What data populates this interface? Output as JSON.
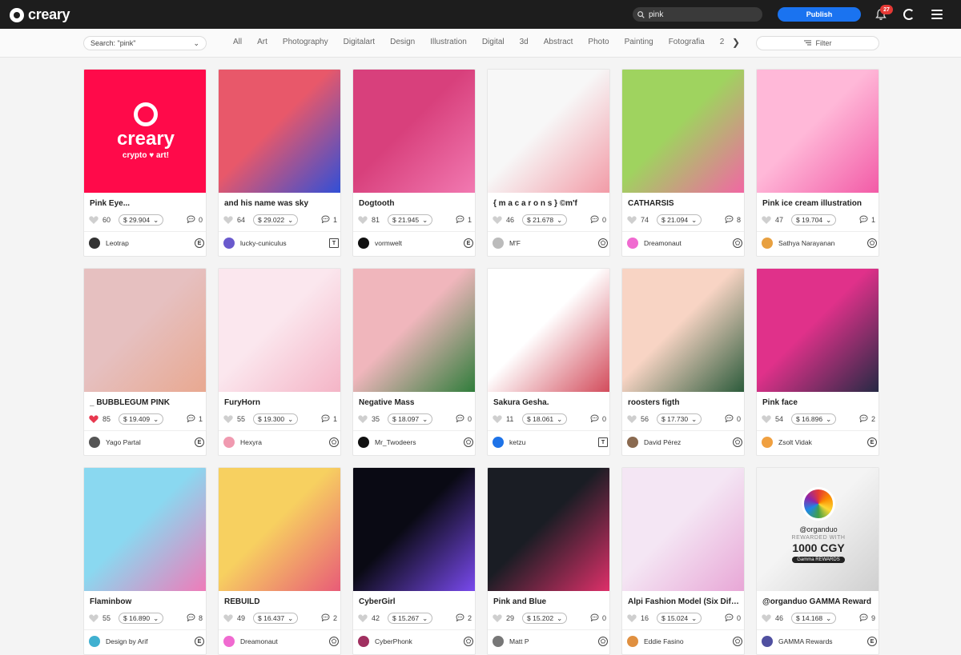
{
  "header": {
    "logo_text": "creary",
    "search_value": "pink",
    "publish_label": "Publish",
    "notification_count": "27",
    "menu_icon": "hamburger-icon"
  },
  "filters": {
    "search_select": "Search: \"pink\"",
    "categories": [
      "All",
      "Art",
      "Photography",
      "Digitalart",
      "Design",
      "Illustration",
      "Digital",
      "3d",
      "Abstract",
      "Photo",
      "Painting",
      "Fotografia",
      "2"
    ],
    "filter_label": "Filter"
  },
  "cards": [
    {
      "title": "Pink Eye...",
      "likes": "60",
      "price": "$ 29.904",
      "comments": "0",
      "author": "Leotrap",
      "net": "E",
      "liked": false,
      "colors": [
        "#ff0a4a",
        "#ff0a4a"
      ],
      "avatar": "#333333"
    },
    {
      "title": "and his name was sky",
      "likes": "64",
      "price": "$ 29.022",
      "comments": "1",
      "author": "lucky-cuniculus",
      "net": "T",
      "liked": false,
      "colors": [
        "#e8586a",
        "#2f4fd8"
      ],
      "avatar": "#6a5acd"
    },
    {
      "title": "Dogtooth",
      "likes": "81",
      "price": "$ 21.945",
      "comments": "1",
      "author": "vormwelt",
      "net": "E",
      "liked": false,
      "colors": [
        "#d8407c",
        "#f27ab2"
      ],
      "avatar": "#111111"
    },
    {
      "title": "{ m a c a r o n s } ©m'f",
      "likes": "46",
      "price": "$ 21.678",
      "comments": "0",
      "author": "M'F",
      "net": "P",
      "liked": false,
      "colors": [
        "#f7f7f7",
        "#f29aa6"
      ],
      "avatar": "#bbbbbb"
    },
    {
      "title": "CATHARSIS",
      "likes": "74",
      "price": "$ 21.094",
      "comments": "8",
      "author": "Dreamonaut",
      "net": "P",
      "liked": false,
      "colors": [
        "#9fd35f",
        "#f266a4"
      ],
      "avatar": "#f06ad0"
    },
    {
      "title": "Pink ice cream illustration",
      "likes": "47",
      "price": "$ 19.704",
      "comments": "1",
      "author": "Sathya Narayanan",
      "net": "P",
      "liked": false,
      "colors": [
        "#ffb8d8",
        "#f25aa6"
      ],
      "avatar": "#e8a040"
    },
    {
      "title": "_ BUBBLEGUM PINK",
      "likes": "85",
      "price": "$ 19.409",
      "comments": "1",
      "author": "Yago Partal",
      "net": "E",
      "liked": true,
      "colors": [
        "#e6c0c0",
        "#e8a890"
      ],
      "avatar": "#555555"
    },
    {
      "title": "FuryHorn",
      "likes": "55",
      "price": "$ 19.300",
      "comments": "1",
      "author": "Hexyra",
      "net": "P",
      "liked": false,
      "colors": [
        "#fbe7ee",
        "#f4b4c6"
      ],
      "avatar": "#f09ab0"
    },
    {
      "title": "Negative Mass",
      "likes": "35",
      "price": "$ 18.097",
      "comments": "0",
      "author": "Mr_Twodeers",
      "net": "P",
      "liked": false,
      "colors": [
        "#f0b6bc",
        "#2e7d3a"
      ],
      "avatar": "#111111"
    },
    {
      "title": "Sakura Gesha.",
      "likes": "11",
      "price": "$ 18.061",
      "comments": "0",
      "author": "ketzu",
      "net": "T",
      "liked": false,
      "colors": [
        "#ffffff",
        "#d24a5a"
      ],
      "avatar": "#1e73e8"
    },
    {
      "title": "roosters figth",
      "likes": "56",
      "price": "$ 17.730",
      "comments": "0",
      "author": "David Pérez",
      "net": "P",
      "liked": false,
      "colors": [
        "#f8d4c4",
        "#2a5a3a"
      ],
      "avatar": "#8a6a50"
    },
    {
      "title": "Pink face",
      "likes": "54",
      "price": "$ 16.896",
      "comments": "2",
      "author": "Zsolt Vidak",
      "net": "E",
      "liked": false,
      "colors": [
        "#e0318a",
        "#242a44"
      ],
      "avatar": "#f0a040"
    },
    {
      "title": "Flaminbow",
      "likes": "55",
      "price": "$ 16.890",
      "comments": "8",
      "author": "Design by Arif",
      "net": "E",
      "liked": false,
      "colors": [
        "#8ad8f0",
        "#f07ab8"
      ],
      "avatar": "#40b0d0"
    },
    {
      "title": "REBUILD",
      "likes": "49",
      "price": "$ 16.437",
      "comments": "2",
      "author": "Dreamonaut",
      "net": "P",
      "liked": false,
      "colors": [
        "#f7d060",
        "#e85a78"
      ],
      "avatar": "#f06ad0"
    },
    {
      "title": "CyberGirl",
      "likes": "42",
      "price": "$ 15.267",
      "comments": "2",
      "author": "CyberPhonk",
      "net": "P",
      "liked": false,
      "colors": [
        "#0a0a14",
        "#7a4af0"
      ],
      "avatar": "#a03060"
    },
    {
      "title": "Pink and Blue",
      "likes": "29",
      "price": "$ 15.202",
      "comments": "0",
      "author": "Matt P",
      "net": "P",
      "liked": false,
      "colors": [
        "#1a1d24",
        "#e0306a"
      ],
      "avatar": "#777777"
    },
    {
      "title": "Alpi Fashion Model (Six Diff...",
      "likes": "16",
      "price": "$ 15.024",
      "comments": "0",
      "author": "Eddie Fasino",
      "net": "P",
      "liked": false,
      "colors": [
        "#f4e6f4",
        "#e8a6d6"
      ],
      "avatar": "#e09040"
    },
    {
      "title": "@organduo GAMMA Reward",
      "likes": "46",
      "price": "$ 14.168",
      "comments": "9",
      "author": "GAMMA Rewards",
      "net": "E",
      "liked": false,
      "colors": [
        "#f4f4f4",
        "#cfcfcf"
      ],
      "avatar": "#5050a0"
    }
  ],
  "promo": {
    "logo_text": "creary",
    "tagline": "crypto ♥ art!",
    "reward_handle": "@organduo",
    "reward_line": "REWARDED WITH",
    "reward_amount": "1000 CGY",
    "reward_brand": "Gamma REWARDS"
  },
  "colors": {
    "topbar_bg": "#1d1d1d",
    "accent": "#1a73f0",
    "badge": "#e53935",
    "liked_heart": "#e8384f"
  }
}
